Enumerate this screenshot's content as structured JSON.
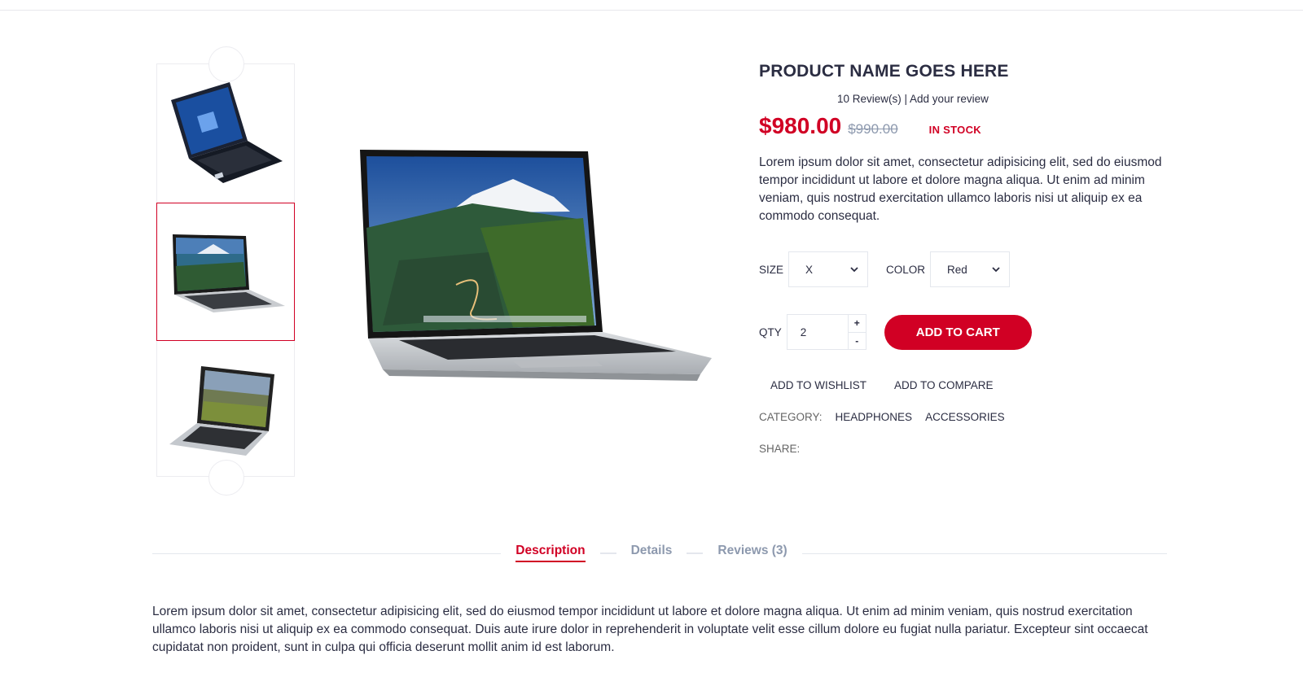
{
  "product": {
    "title": "PRODUCT NAME GOES HERE",
    "reviews_text": "10 Review(s) | Add your review",
    "price": "$980.00",
    "old_price": "$990.00",
    "stock": "IN STOCK",
    "description": "Lorem ipsum dolor sit amet, consectetur adipisicing elit, sed do eiusmod tempor incididunt ut labore et dolore magna aliqua. Ut enim ad minim veniam, quis nostrud exercitation ullamco laboris nisi ut aliquip ex ea commodo consequat."
  },
  "options": {
    "size_label": "SIZE",
    "size_value": "X",
    "color_label": "COLOR",
    "color_value": "Red"
  },
  "quantity": {
    "label": "QTY",
    "value": "2",
    "plus": "+",
    "minus": "-"
  },
  "actions": {
    "add_to_cart": "ADD TO CART",
    "add_to_wishlist": "ADD TO WISHLIST",
    "add_to_compare": "ADD TO COMPARE"
  },
  "category": {
    "label": "CATEGORY:",
    "items": [
      "HEADPHONES",
      "ACCESSORIES"
    ]
  },
  "share_label": "SHARE:",
  "tabs": [
    {
      "label": "Description"
    },
    {
      "label": "Details"
    },
    {
      "label": "Reviews (3)"
    }
  ],
  "tab_content": "Lorem ipsum dolor sit amet, consectetur adipisicing elit, sed do eiusmod tempor incididunt ut labore et dolore magna aliqua. Ut enim ad minim veniam, quis nostrud exercitation ullamco laboris nisi ut aliquip ex ea commodo consequat. Duis aute irure dolor in reprehenderit in voluptate velit esse cillum dolore eu fugiat nulla pariatur. Excepteur sint occaecat cupidatat non proident, sunt in culpa qui officia deserunt mollit anim id est laborum.",
  "colors": {
    "accent": "#d10024",
    "text": "#2b2d42",
    "muted": "#8d99ae"
  }
}
